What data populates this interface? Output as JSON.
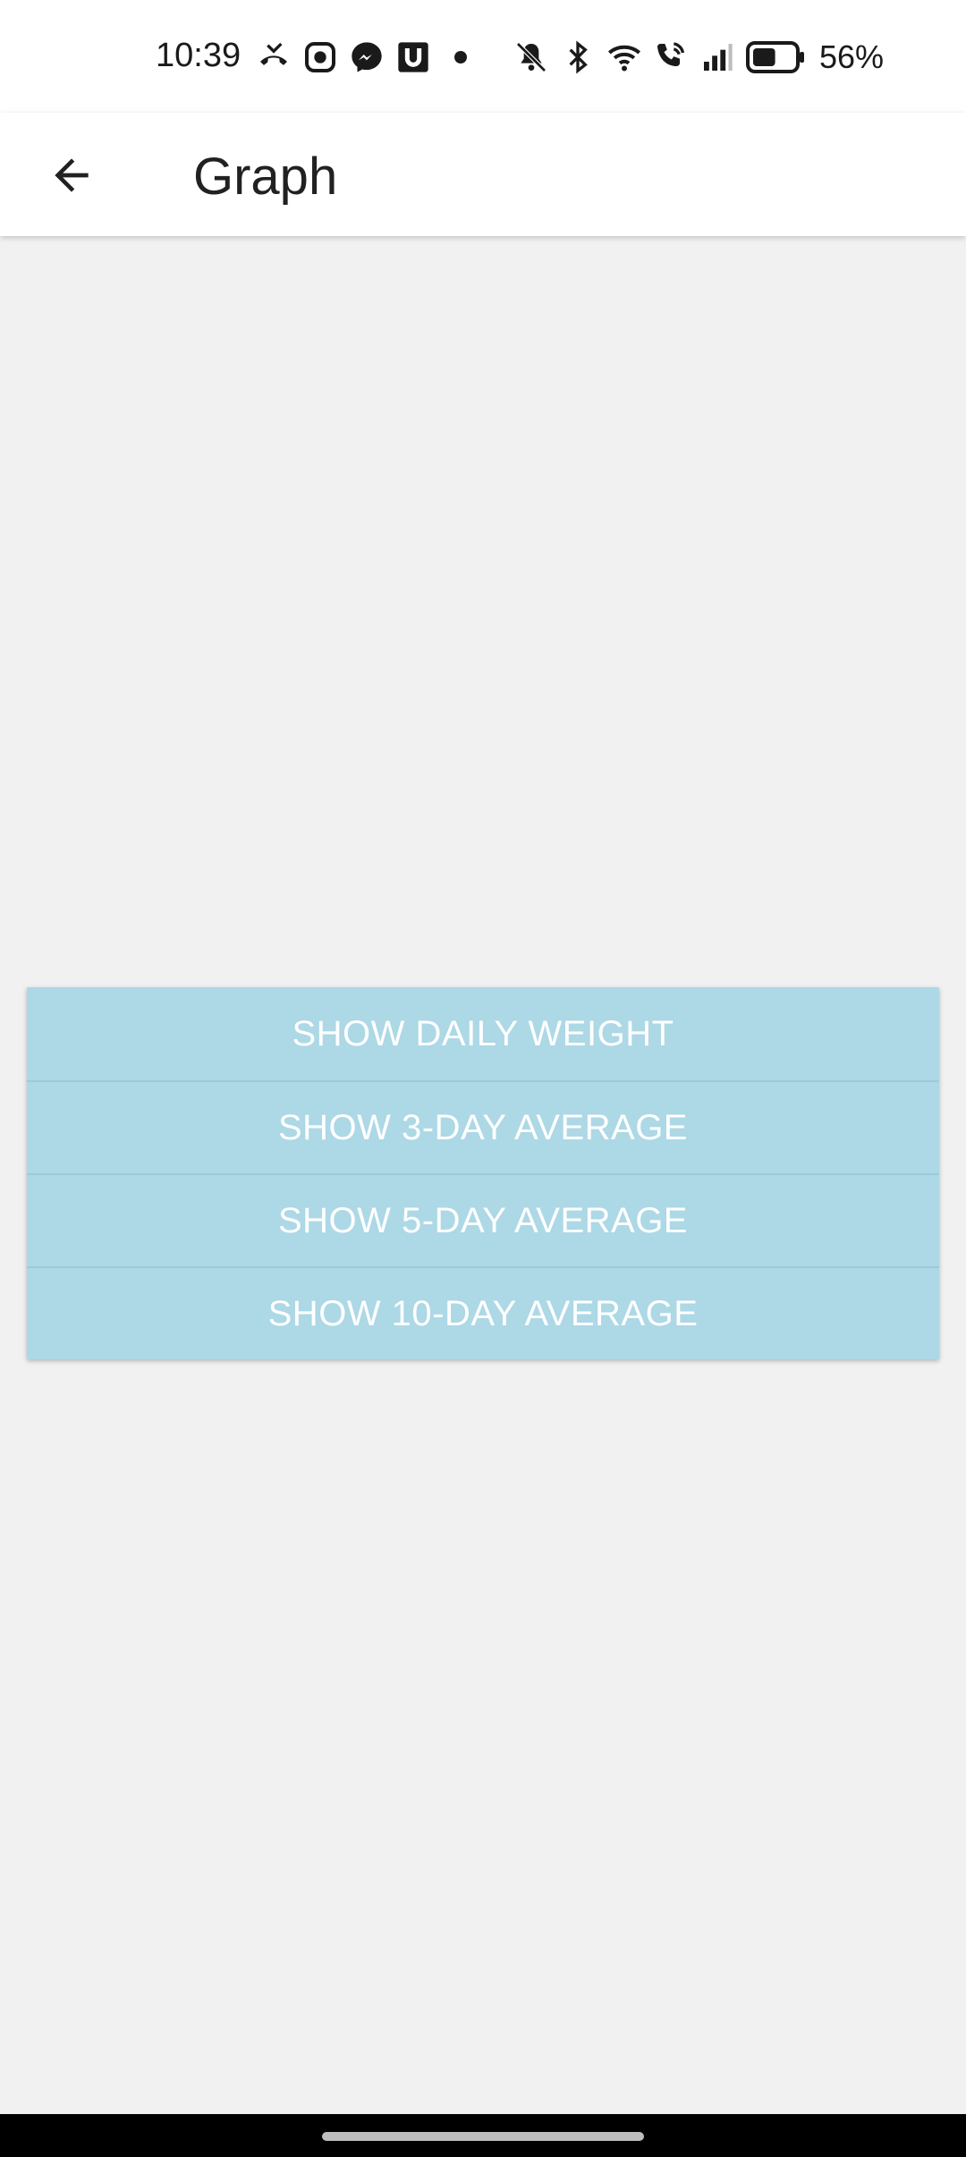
{
  "status_bar": {
    "time": "10:39",
    "battery_percent": "56%",
    "left_icons": [
      "missed-call-icon",
      "messenger-bubble-icon",
      "messenger-icon",
      "u-app-icon",
      "notification-dot-icon"
    ],
    "right_icons": [
      "mute-icon",
      "bluetooth-icon",
      "wifi-icon",
      "wifi-calling-icon",
      "signal-icon",
      "battery-icon"
    ],
    "battery_level": 0.56
  },
  "app_bar": {
    "title": "Graph",
    "back_icon": "arrow-back-icon"
  },
  "options": {
    "daily": "SHOW DAILY WEIGHT",
    "avg3": "SHOW 3-DAY AVERAGE",
    "avg5": "SHOW 5-DAY AVERAGE",
    "avg10": "SHOW 10-DAY AVERAGE"
  },
  "colors": {
    "button_background": "#add8e6",
    "button_text": "#ffffff",
    "page_background": "#f1f1f1",
    "app_bar_background": "#ffffff"
  }
}
